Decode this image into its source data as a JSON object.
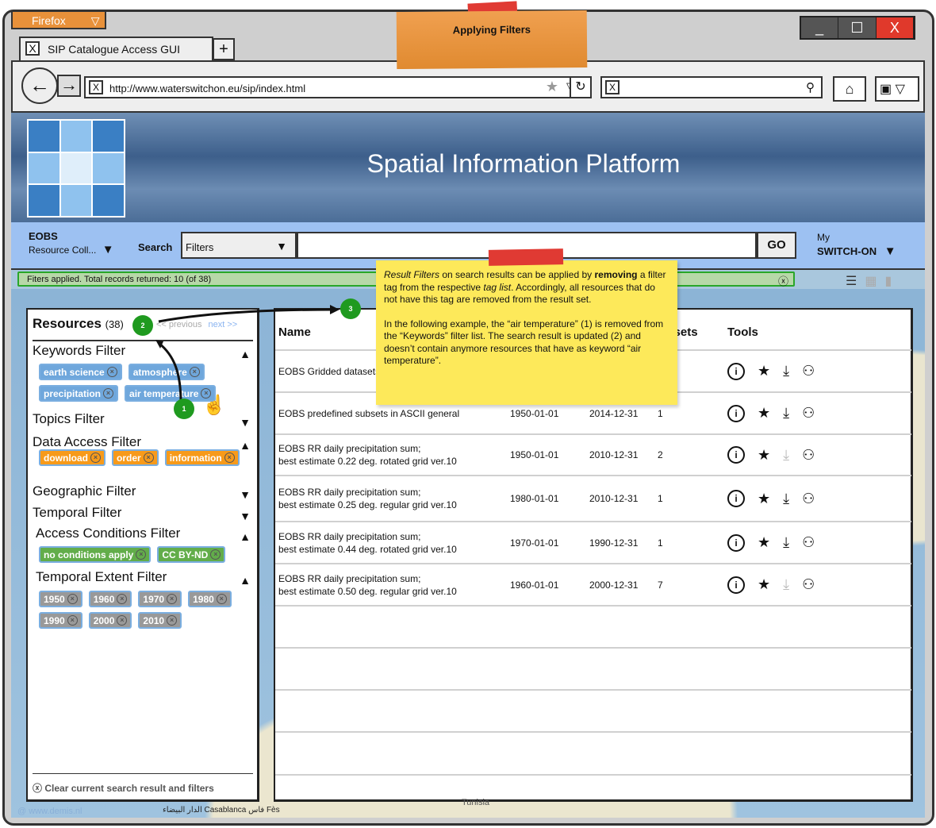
{
  "browser": {
    "menu": "Firefox",
    "tab_title": "SIP Catalogue Access GUI",
    "new_tab": "+",
    "url": "http://www.waterswitchon.eu/sip/index.html",
    "win_min": "_",
    "win_max": "☐",
    "win_close": "X"
  },
  "sticky_title": "Applying Filters",
  "banner": {
    "title": "Spatial Information Platform"
  },
  "toolbar": {
    "collection_label": "EOBS",
    "collection_value": "Resource Coll...",
    "search_label": "Search",
    "filter_select": "Filters",
    "go": "GO",
    "account_line1": "My",
    "account_line2": "SWITCH-ON"
  },
  "status": "Fiters applied. Total records returned: 10 (of 38)",
  "left": {
    "title": "Resources",
    "count": "(38)",
    "prev": "<< previous",
    "next": "next >>",
    "filters": [
      {
        "name": "Keywords Filter",
        "expanded": true,
        "tags": [
          "earth science",
          "atmosphere",
          "precipitation",
          "air temperature"
        ]
      },
      {
        "name": "Topics Filter",
        "expanded": false,
        "tags": []
      },
      {
        "name": "Data Access Filter",
        "expanded": true,
        "tags": [
          "download",
          "order",
          "information"
        ]
      },
      {
        "name": "Geographic Filter",
        "expanded": false,
        "tags": []
      },
      {
        "name": "Temporal Filter",
        "expanded": false,
        "tags": []
      },
      {
        "name": "Access Conditions Filter",
        "expanded": true,
        "tags": [
          "no conditions apply",
          "CC BY-ND"
        ]
      },
      {
        "name": "Temporal Extent Filter",
        "expanded": true,
        "tags": [
          "1950",
          "1960",
          "1970",
          "1980",
          "1990",
          "2000",
          "2010"
        ]
      }
    ],
    "clear": "Clear current search result and filters"
  },
  "table": {
    "headers": {
      "name": "Name",
      "datasets": "Datasets",
      "tools": "Tools"
    },
    "rows": [
      {
        "name": "EOBS Gridded datasets",
        "start": "",
        "end": "",
        "datasets": "",
        "download_enabled": true
      },
      {
        "name": "EOBS predefined subsets in ASCII general",
        "start": "1950-01-01",
        "end": "2014-12-31",
        "datasets": "1",
        "download_enabled": true
      },
      {
        "name": "EOBS RR daily precipitation sum;\nbest estimate 0.22 deg. rotated grid ver.10",
        "start": "1950-01-01",
        "end": "2010-12-31",
        "datasets": "2",
        "download_enabled": false
      },
      {
        "name": "EOBS RR daily precipitation sum;\nbest estimate 0.25 deg. regular grid ver.10",
        "start": "1980-01-01",
        "end": "2010-12-31",
        "datasets": "1",
        "download_enabled": true
      },
      {
        "name": "EOBS RR daily precipitation sum;\nbest estimate 0.44 deg. rotated grid ver.10",
        "start": "1970-01-01",
        "end": "1990-12-31",
        "datasets": "1",
        "download_enabled": true
      },
      {
        "name": "EOBS RR daily precipitation sum;\nbest estimate 0.50 deg. regular grid ver.10",
        "start": "1960-01-01",
        "end": "2000-12-31",
        "datasets": "7",
        "download_enabled": false
      }
    ]
  },
  "note": {
    "p1_em": "Result Filters",
    "p1_a": " on search results can be applied by ",
    "p1_b": "removing",
    "p1_c": " a filter tag from the respective ",
    "p1_em2": "tag list",
    "p1_d": ". Accordingly, all resources that do not have this tag are removed from the result set.",
    "p2": "In the following example, the “air temperature” (1) is removed from the “Keywords” filter list. The search result is updated (2) and doesn’t contain anymore resources that have as keyword “air temperature”."
  },
  "badges": [
    "1",
    "2",
    "3"
  ],
  "map": {
    "credit": "@ www.demis.nl",
    "cities": "الدار البيضاء Casablanca  فاس Fès",
    "country": "Tunisia"
  },
  "colors": {
    "keyword_tag": "#6fa7dc",
    "access_tag": "#f79a1a",
    "conditions_tag": "#62ad4a",
    "temporal_tag": "#999999",
    "status_bg": "#b7d8a8",
    "toolbar_bg": "#9dc1f2",
    "note": "#fde95a"
  }
}
